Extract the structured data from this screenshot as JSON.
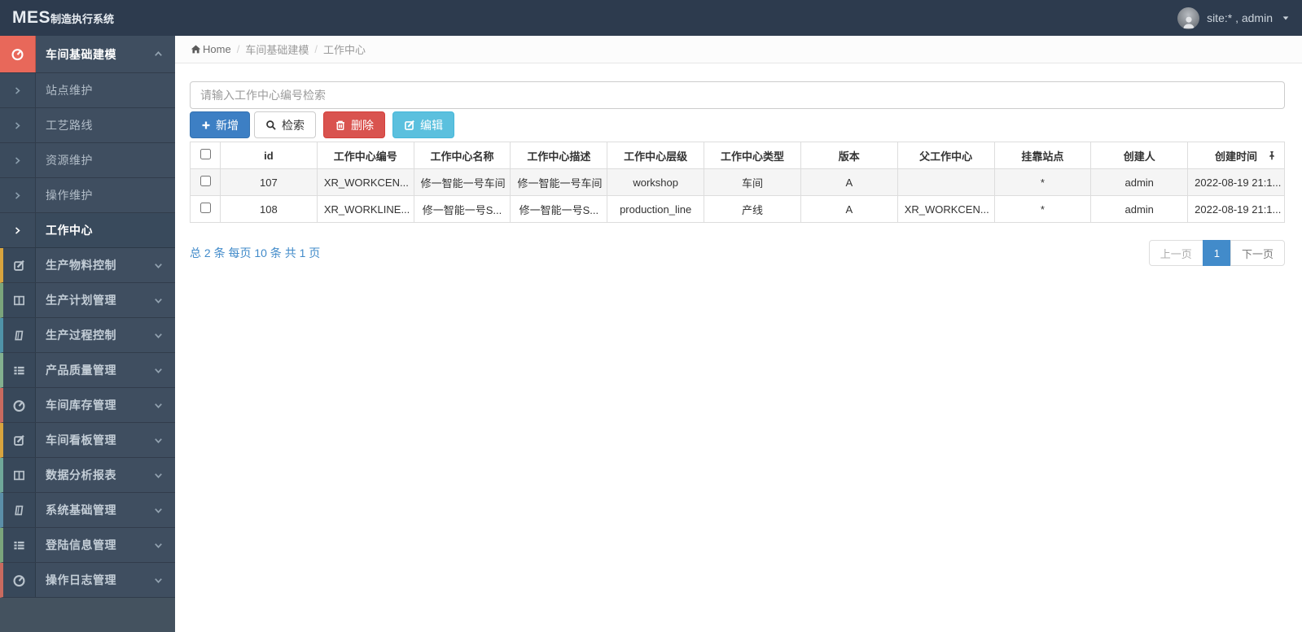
{
  "topbar": {
    "logo_main": "MES",
    "logo_sub": "制造执行系统",
    "user_label": "site:* , admin"
  },
  "sidebar": {
    "groups": [
      {
        "label": "车间基础建模",
        "icon": "gauge-icon",
        "expanded": true,
        "active": true
      },
      {
        "label": "生产物料控制",
        "icon": "edit-icon",
        "strip_color": "#d8a43e"
      },
      {
        "label": "生产计划管理",
        "icon": "columns-icon",
        "strip_color": "#7ba57b"
      },
      {
        "label": "生产过程控制",
        "icon": "book-icon",
        "strip_color": "#4f93a8"
      },
      {
        "label": "产品质量管理",
        "icon": "list-icon",
        "strip_color": "#83b08f"
      },
      {
        "label": "车间库存管理",
        "icon": "gauge-icon",
        "strip_color": "#c96a5f"
      },
      {
        "label": "车间看板管理",
        "icon": "edit-icon",
        "strip_color": "#d8a43e"
      },
      {
        "label": "数据分析报表",
        "icon": "columns-icon",
        "strip_color": "#6fa899"
      },
      {
        "label": "系统基础管理",
        "icon": "book-icon",
        "strip_color": "#5b8fa8"
      },
      {
        "label": "登陆信息管理",
        "icon": "list-icon",
        "strip_color": "#7ba57b"
      },
      {
        "label": "操作日志管理",
        "icon": "gauge-icon",
        "strip_color": "#c96a5f"
      }
    ],
    "submenu": [
      {
        "label": "站点维护",
        "active": false
      },
      {
        "label": "工艺路线",
        "active": false
      },
      {
        "label": "资源维护",
        "active": false
      },
      {
        "label": "操作维护",
        "active": false
      },
      {
        "label": "工作中心",
        "active": true
      }
    ]
  },
  "breadcrumb": {
    "home": "Home",
    "items": [
      "车间基础建模",
      "工作中心"
    ]
  },
  "search": {
    "placeholder": "请输入工作中心编号检索",
    "value": ""
  },
  "toolbar": {
    "add_label": "新增",
    "search_label": "检索",
    "delete_label": "删除",
    "edit_label": "编辑"
  },
  "table": {
    "columns": [
      "id",
      "工作中心编号",
      "工作中心名称",
      "工作中心描述",
      "工作中心层级",
      "工作中心类型",
      "版本",
      "父工作中心",
      "挂靠站点",
      "创建人",
      "创建时间"
    ],
    "rows": [
      [
        "107",
        "XR_WORKCEN...",
        "修一智能一号车间",
        "修一智能一号车间",
        "workshop",
        "车间",
        "A",
        "",
        "*",
        "admin",
        "2022-08-19 21:1..."
      ],
      [
        "108",
        "XR_WORKLINE...",
        "修一智能一号S...",
        "修一智能一号S...",
        "production_line",
        "产线",
        "A",
        "XR_WORKCEN...",
        "*",
        "admin",
        "2022-08-19 21:1..."
      ]
    ]
  },
  "pagination": {
    "summary": "总 2 条 每页 10 条 共 1 页",
    "prev_label": "上一页",
    "page_label": "1",
    "next_label": "下一页"
  },
  "colors": {
    "topbar_bg": "#2d3b4e",
    "sidebar_item_bg": "#3f4e60",
    "sidebar_icon_bg": "#38485a",
    "active_accent": "#e8685a",
    "primary_btn": "#3d7fc4",
    "danger_btn": "#d9534f",
    "info_btn": "#5bc0de",
    "link_blue": "#428bca",
    "page_active_bg": "#428bca"
  }
}
